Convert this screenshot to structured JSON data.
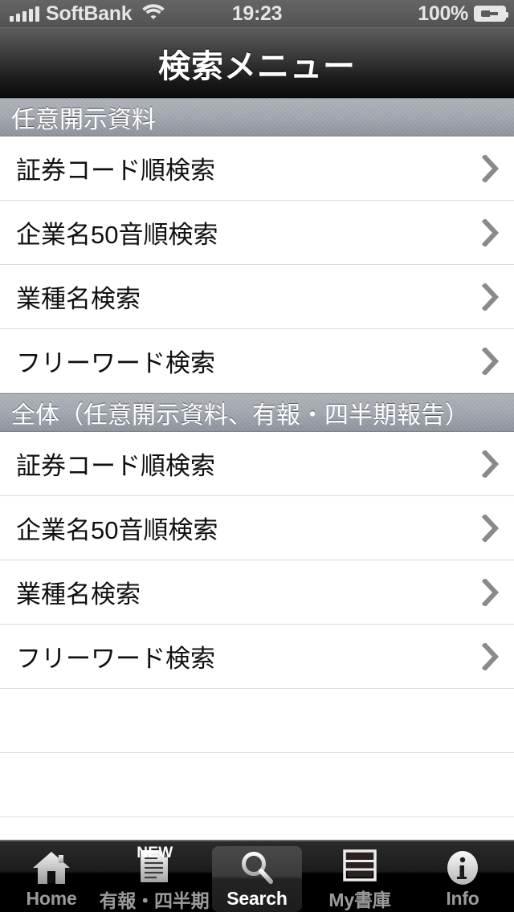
{
  "status_bar": {
    "carrier": "SoftBank",
    "signal_icon": "signal-bars-icon",
    "wifi_icon": "wifi-icon",
    "time": "19:23",
    "battery_percent": "100%",
    "battery_icon": "battery-charging-icon"
  },
  "nav": {
    "title": "検索メニュー"
  },
  "sections": [
    {
      "header": "任意開示資料",
      "rows": [
        {
          "label": "証券コード順検索",
          "accessory": "chevron-right-icon"
        },
        {
          "label": "企業名50音順検索",
          "accessory": "chevron-right-icon"
        },
        {
          "label": "業種名検索",
          "accessory": "chevron-right-icon"
        },
        {
          "label": "フリーワード検索",
          "accessory": "chevron-right-icon"
        }
      ]
    },
    {
      "header": "全体（任意開示資料、有報・四半期報告）",
      "rows": [
        {
          "label": "証券コード順検索",
          "accessory": "chevron-right-icon"
        },
        {
          "label": "企業名50音順検索",
          "accessory": "chevron-right-icon"
        },
        {
          "label": "業種名検索",
          "accessory": "chevron-right-icon"
        },
        {
          "label": "フリーワード検索",
          "accessory": "chevron-right-icon"
        }
      ]
    }
  ],
  "empty_rows_count": 3,
  "tab_bar": {
    "selected_index": 2,
    "tabs": [
      {
        "label": "Home",
        "icon": "home-icon",
        "badge": ""
      },
      {
        "label": "有報・四半期",
        "icon": "document-icon",
        "badge": "NEW"
      },
      {
        "label": "Search",
        "icon": "search-icon",
        "badge": ""
      },
      {
        "label": "My書庫",
        "icon": "bookshelf-icon",
        "badge": ""
      },
      {
        "label": "Info",
        "icon": "info-icon",
        "badge": ""
      }
    ]
  },
  "colors": {
    "status_bar_bg": "#5b5b5b",
    "nav_bar_top": "#5d5d5d",
    "nav_bar_bottom": "#0a0a0a",
    "section_header_bg": "#a2a6ae",
    "cell_bg": "#ffffff",
    "cell_separator": "#dcdcdc",
    "chevron": "#8a8a8a",
    "tab_bar_bg": "#000000",
    "tab_selected_bg": "#3b3b3b",
    "tab_label_inactive": "#9b9b9b",
    "tab_label_active": "#ffffff"
  }
}
